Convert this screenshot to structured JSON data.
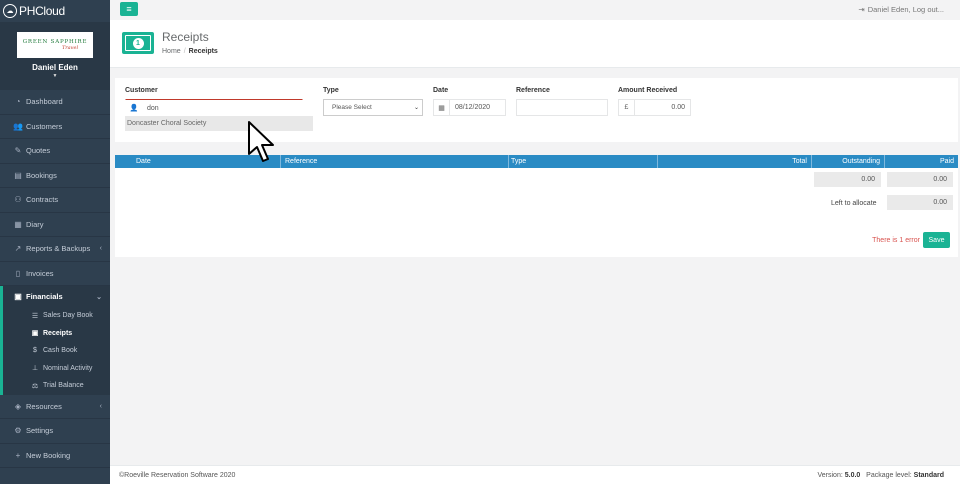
{
  "brand": {
    "name": "PHCloud"
  },
  "profile": {
    "logo_line1": "GREEN SAPPHIRE",
    "logo_line2": "Travel",
    "user": "Daniel Eden"
  },
  "sidebar": {
    "items": [
      {
        "label": "Dashboard",
        "icon": "dashboard-icon"
      },
      {
        "label": "Customers",
        "icon": "users-icon"
      },
      {
        "label": "Quotes",
        "icon": "pencil-icon"
      },
      {
        "label": "Bookings",
        "icon": "book-icon"
      },
      {
        "label": "Contracts",
        "icon": "handshake-icon"
      },
      {
        "label": "Diary",
        "icon": "calendar-icon"
      },
      {
        "label": "Reports & Backups",
        "icon": "chart-icon"
      },
      {
        "label": "Invoices",
        "icon": "file-icon"
      },
      {
        "label": "Financials",
        "icon": "money-icon"
      }
    ],
    "financials_sub": [
      {
        "label": "Sales Day Book",
        "icon": "list-icon"
      },
      {
        "label": "Receipts",
        "icon": "money-icon"
      },
      {
        "label": "Cash Book",
        "icon": "dollar-icon"
      },
      {
        "label": "Nominal Activity",
        "icon": "sitemap-icon"
      },
      {
        "label": "Trial Balance",
        "icon": "balance-icon"
      }
    ],
    "bottom_items": [
      {
        "label": "Resources",
        "icon": "cube-icon"
      },
      {
        "label": "Settings",
        "icon": "cogs-icon"
      },
      {
        "label": "New Booking",
        "icon": "plus-icon"
      }
    ]
  },
  "topbar": {
    "logout": "Daniel Eden, Log out..."
  },
  "heading": {
    "title": "Receipts",
    "crumb_home": "Home",
    "crumb_current": "Receipts"
  },
  "form": {
    "customer_label": "Customer",
    "customer_value": "don",
    "customer_suggestion": "Doncaster Choral Society",
    "type_label": "Type",
    "type_value": "Please Select",
    "date_label": "Date",
    "date_value": "08/12/2020",
    "reference_label": "Reference",
    "reference_value": "",
    "amount_label": "Amount Received",
    "amount_currency": "£",
    "amount_value": "0.00"
  },
  "table": {
    "headers": {
      "date": "Date",
      "reference": "Reference",
      "type": "Type",
      "total": "Total",
      "outstanding": "Outstanding",
      "paid": "Paid"
    },
    "outstanding_total": "0.00",
    "paid_total": "0.00",
    "left_to_allocate_label": "Left to allocate",
    "left_to_allocate": "0.00",
    "error_text": "There is 1 error",
    "save_label": "Save"
  },
  "footer": {
    "copyright": "©Roeville Reservation Software 2020",
    "version_label": "Version:",
    "version": "5.0.0",
    "package_label": "Package level:",
    "package": "Standard"
  },
  "colors": {
    "accent": "#1ab394",
    "sidebar": "#2f4050",
    "table_header": "#2a8bc4",
    "error": "#d9534f"
  }
}
